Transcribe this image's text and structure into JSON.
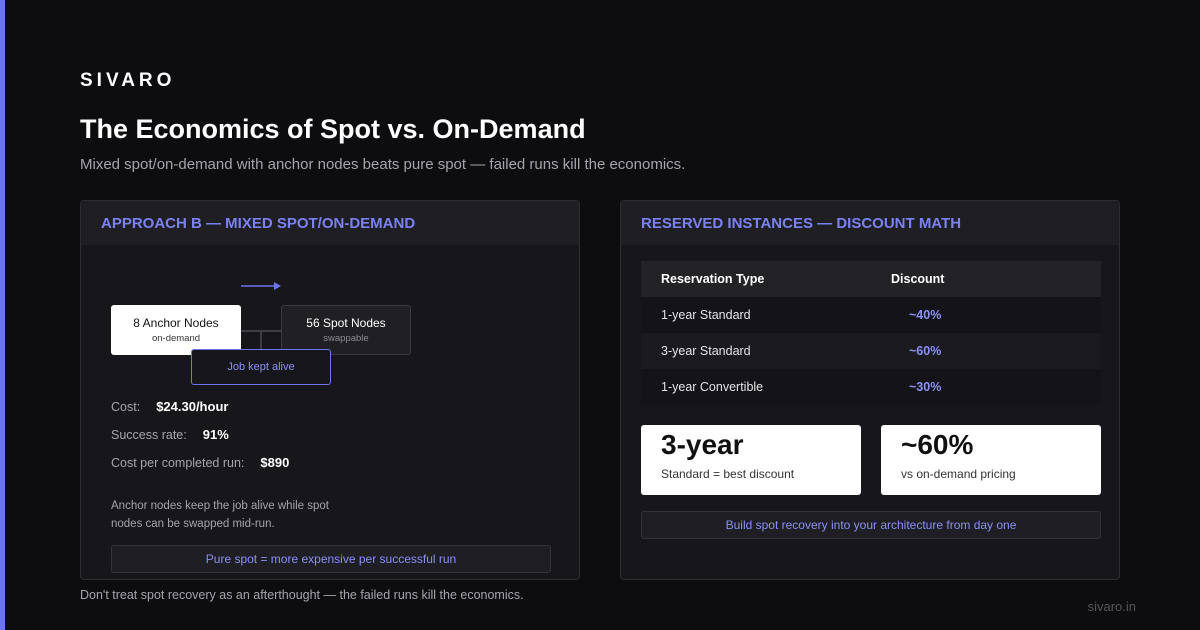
{
  "brand": "SIVARO",
  "title": "The Economics of Spot vs. On-Demand",
  "subtitle": "Mixed spot/on-demand with anchor nodes beats pure spot — failed runs kill the economics.",
  "colors": {
    "accent": "#6c74f0",
    "background": "#0d0d10",
    "panel": "#17171b",
    "panel_header": "#1e1e23"
  },
  "left_panel": {
    "header": "APPROACH B — MIXED SPOT/ON-DEMAND",
    "anchor_node": {
      "title": "8 Anchor Nodes",
      "subtitle": "on-demand"
    },
    "spot_node": {
      "title": "56 Spot Nodes",
      "subtitle": "swappable"
    },
    "job_node": {
      "title": "Job kept alive"
    },
    "metrics": [
      {
        "label": "Cost:",
        "value": "$24.30/hour"
      },
      {
        "label": "Success rate:",
        "value": "91%"
      },
      {
        "label": "Cost per completed run:",
        "value": "$890"
      }
    ],
    "note": "Anchor nodes keep the job alive while spot nodes can be swapped mid-run.",
    "callout": "Pure spot = more expensive per successful run"
  },
  "right_panel": {
    "header": "RESERVED INSTANCES — DISCOUNT MATH",
    "table": {
      "headers": [
        "Reservation Type",
        "Discount"
      ],
      "rows": [
        {
          "type": "1-year Standard",
          "discount": "~40%"
        },
        {
          "type": "3-year Standard",
          "discount": "~60%"
        },
        {
          "type": "1-year Convertible",
          "discount": "~30%"
        }
      ]
    },
    "stats": [
      {
        "big": "3-year",
        "small": "Standard = best discount"
      },
      {
        "big": "~60%",
        "small": "vs on-demand pricing"
      }
    ],
    "callout": "Build spot recovery into your architecture from day one"
  },
  "footer_note": "Don't treat spot recovery as an afterthought — the failed runs kill the economics.",
  "site": "sivaro.in"
}
